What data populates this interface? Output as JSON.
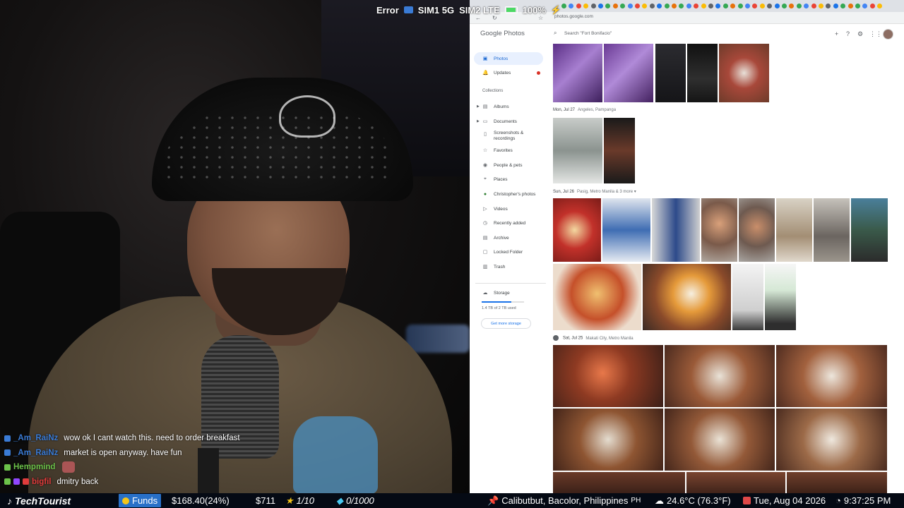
{
  "overlay": {
    "error": "Error",
    "sim1": "SIM1 5G",
    "sim2": "SIM2 LTE",
    "battery": "100%"
  },
  "chat": [
    {
      "user": "_Am_RaiNz",
      "user_color": "#3a7bd5",
      "message": "wow ok I cant watch this. need to order breakfast"
    },
    {
      "user": "_Am_RaiNz",
      "user_color": "#3a7bd5",
      "message": "market is open anyway. have fun"
    },
    {
      "user": "Hempmind",
      "user_color": "#6cc24a",
      "message": ""
    },
    {
      "user": "bigfil",
      "user_color": "#e03c3c",
      "message": "dmitry back"
    }
  ],
  "ticker": {
    "brand": "TechTourist",
    "funds_label": "Funds",
    "funds_value": "$168.40(24%)",
    "amount": "$711",
    "ratio1": "1/10",
    "ratio2": "0/1000",
    "location": "Calibutbut, Bacolor, Philippines",
    "location_suffix": "PH",
    "weather": "24.6°C (76.3°F)",
    "date": "Tue, Aug 04 2026",
    "time": "9:37:25 PM"
  },
  "browser": {
    "url": "photos.google.com"
  },
  "gphotos": {
    "logo_google": "Google",
    "logo_photos": "Photos",
    "search_placeholder": "Search \"Fort Bonifacio\"",
    "sidebar": {
      "items": [
        {
          "label": "Photos",
          "icon": "photo-icon"
        },
        {
          "label": "Updates",
          "icon": "bell-icon"
        }
      ],
      "collections_heading": "Collections",
      "collections": [
        {
          "label": "Albums",
          "icon": "album-icon"
        },
        {
          "label": "Documents",
          "icon": "document-icon"
        },
        {
          "label": "Screenshots &",
          "label2": "recordings",
          "icon": "screenshot-icon"
        },
        {
          "label": "Favorites",
          "icon": "star-icon"
        },
        {
          "label": "People & pets",
          "icon": "person-icon"
        },
        {
          "label": "Places",
          "icon": "pin-icon"
        },
        {
          "label": "Christopher's photos",
          "icon": "avatar-icon"
        },
        {
          "label": "Videos",
          "icon": "video-icon"
        },
        {
          "label": "Recently added",
          "icon": "clock-icon"
        },
        {
          "label": "Archive",
          "icon": "archive-icon"
        },
        {
          "label": "Locked Folder",
          "icon": "lock-icon"
        },
        {
          "label": "Trash",
          "icon": "trash-icon"
        }
      ],
      "storage_label": "Storage",
      "storage_used": "1.4 TB of 2 TB used",
      "storage_fraction": 0.7,
      "get_storage": "Get more storage"
    },
    "days": [
      {
        "date": "Mon, Jul 27",
        "location": "Angeles, Pampanga"
      },
      {
        "date": "Sun, Jul 26",
        "location": "Pasig, Metro Manila & 3 more ▾"
      },
      {
        "date": "Sat, Jul 25",
        "location": "Makati City, Metro Manila"
      }
    ]
  }
}
